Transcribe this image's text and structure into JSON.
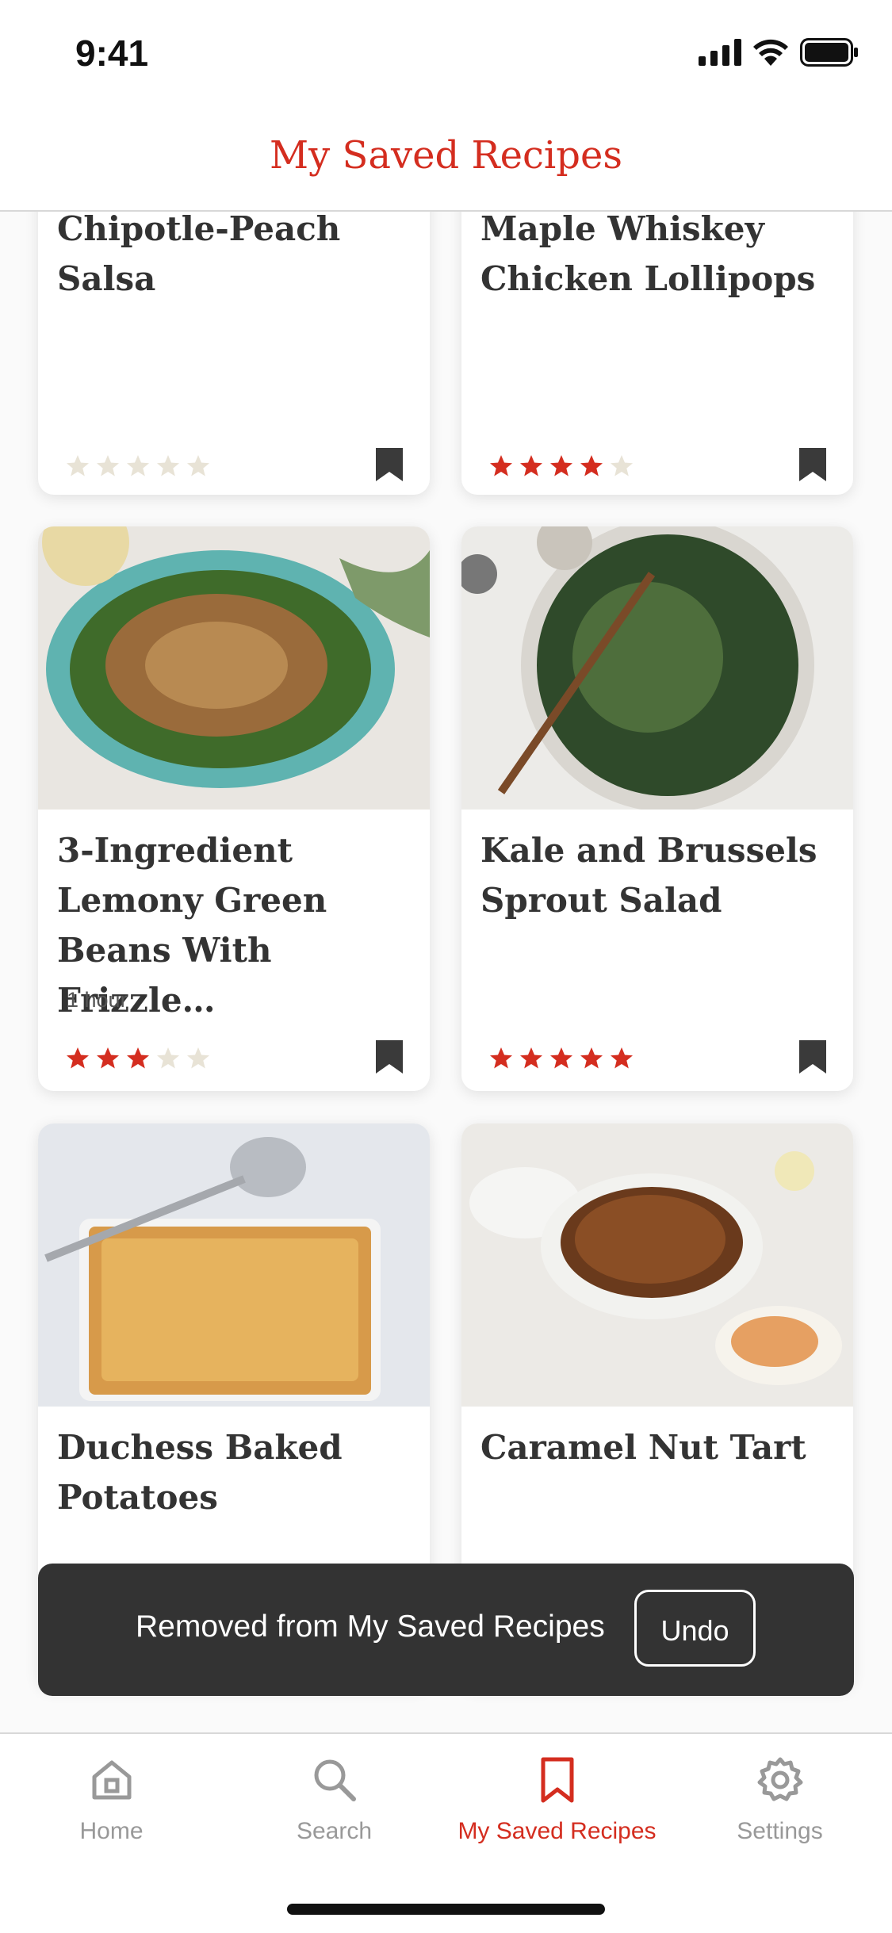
{
  "status_bar": {
    "time": "9:41"
  },
  "header": {
    "title": "My Saved Recipes"
  },
  "colors": {
    "accent": "#d42d1f",
    "star_empty": "#e8e3d6",
    "toast_bg": "#333333"
  },
  "recipes": [
    {
      "title": "Chipotle-Peach Salsa",
      "meta": "",
      "rating": 0,
      "saved": true
    },
    {
      "title": "Maple Whiskey Chicken Lollipops",
      "meta": "",
      "rating": 4,
      "saved": true
    },
    {
      "title": "3-Ingredient Lemony Green Beans With Frizzle…",
      "meta": "1 hour",
      "rating": 3,
      "saved": true
    },
    {
      "title": "Kale and Brussels Sprout Salad",
      "meta": "",
      "rating": 5,
      "saved": true
    },
    {
      "title": "Duchess Baked Potatoes",
      "meta": "",
      "rating": null,
      "saved": true
    },
    {
      "title": "Caramel Nut Tart",
      "meta": "",
      "rating": null,
      "saved": true
    }
  ],
  "toast": {
    "message": "Removed from My Saved Recipes",
    "undo_label": "Undo"
  },
  "tabbar": {
    "home": "Home",
    "search": "Search",
    "saved": "My Saved Recipes",
    "settings": "Settings",
    "active": "saved"
  }
}
